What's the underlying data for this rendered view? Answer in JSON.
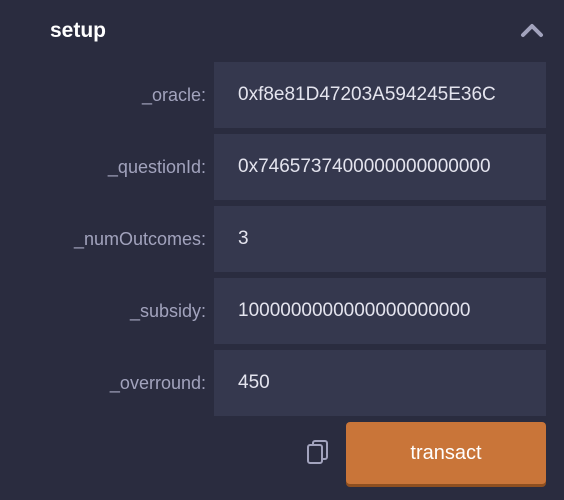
{
  "header": {
    "title": "setup",
    "collapse_icon": "chevron-up-icon"
  },
  "fields": [
    {
      "label": "_oracle:",
      "value": "0xf8e81D47203A594245E36C"
    },
    {
      "label": "_questionId:",
      "value": "0x7465737400000000000000"
    },
    {
      "label": "_numOutcomes:",
      "value": "3"
    },
    {
      "label": "_subsidy:",
      "value": "1000000000000000000000"
    },
    {
      "label": "_overround:",
      "value": "450"
    }
  ],
  "actions": {
    "copy_icon": "copy-icon",
    "transact_label": "transact"
  },
  "colors": {
    "background": "#2a2c3f",
    "field_background": "#35384e",
    "label": "#a2a3bd",
    "accent": "#c97539"
  }
}
